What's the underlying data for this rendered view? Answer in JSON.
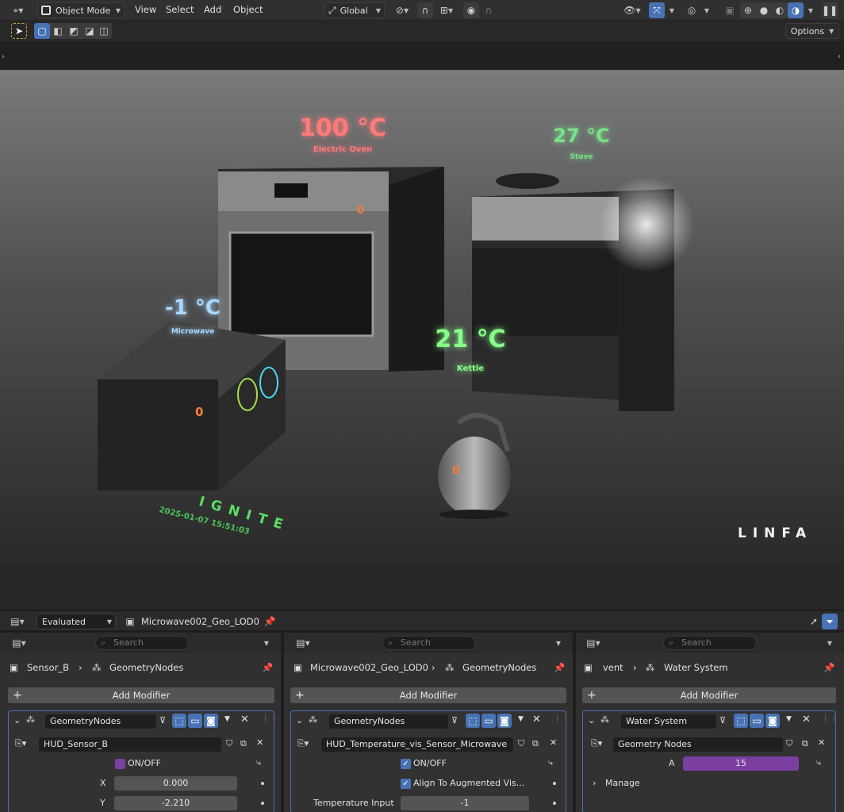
{
  "header": {
    "mode": "Object Mode",
    "menus": [
      "View",
      "Select",
      "Add",
      "Object"
    ],
    "transform_orientation": "Global",
    "options": "Options"
  },
  "viewport": {
    "appliances": [
      {
        "temp": "100 °C",
        "name": "Electric Oven",
        "color": "#ff7a7a"
      },
      {
        "temp": "27 °C",
        "name": "Stove",
        "color": "#7be08a"
      },
      {
        "temp": "-1 °C",
        "name": "Microwave",
        "color": "#a8d8ff"
      },
      {
        "temp": "21 °C",
        "name": "Kettle",
        "color": "#88ff88"
      }
    ],
    "digit": "0",
    "ignite": "IGNITE",
    "datetime": "2025-01-07 15:51:03",
    "brand": "LINFA"
  },
  "bar": {
    "evaluated": "Evaluated",
    "object": "Microwave002_Geo_LOD0"
  },
  "panels": [
    {
      "search": "Search",
      "object": "Sensor_B",
      "modifier": "GeometryNodes",
      "add_modifier": "Add Modifier",
      "mod_name": "GeometryNodes",
      "node_group": "HUD_Sensor_B",
      "onoff": "ON/OFF",
      "x_label": "X",
      "x_value": "0.000",
      "y_label": "Y",
      "y_value": "-2.210"
    },
    {
      "search": "Search",
      "object": "Microwave002_Geo_LOD0",
      "modifier": "GeometryNodes",
      "add_modifier": "Add Modifier",
      "mod_name": "GeometryNodes",
      "node_group": "HUD_Temperature_vis_Sensor_Microwave",
      "onoff": "ON/OFF",
      "align": "Align To Augmented Vis...",
      "temp_label": "Temperature Input",
      "temp_value": "-1"
    },
    {
      "search": "Search",
      "object": "vent",
      "modifier": "Water System",
      "add_modifier": "Add Modifier",
      "mod_name": "Water System",
      "node_group": "Geometry Nodes",
      "a_label": "A",
      "a_value": "15",
      "manage": "Manage"
    }
  ]
}
